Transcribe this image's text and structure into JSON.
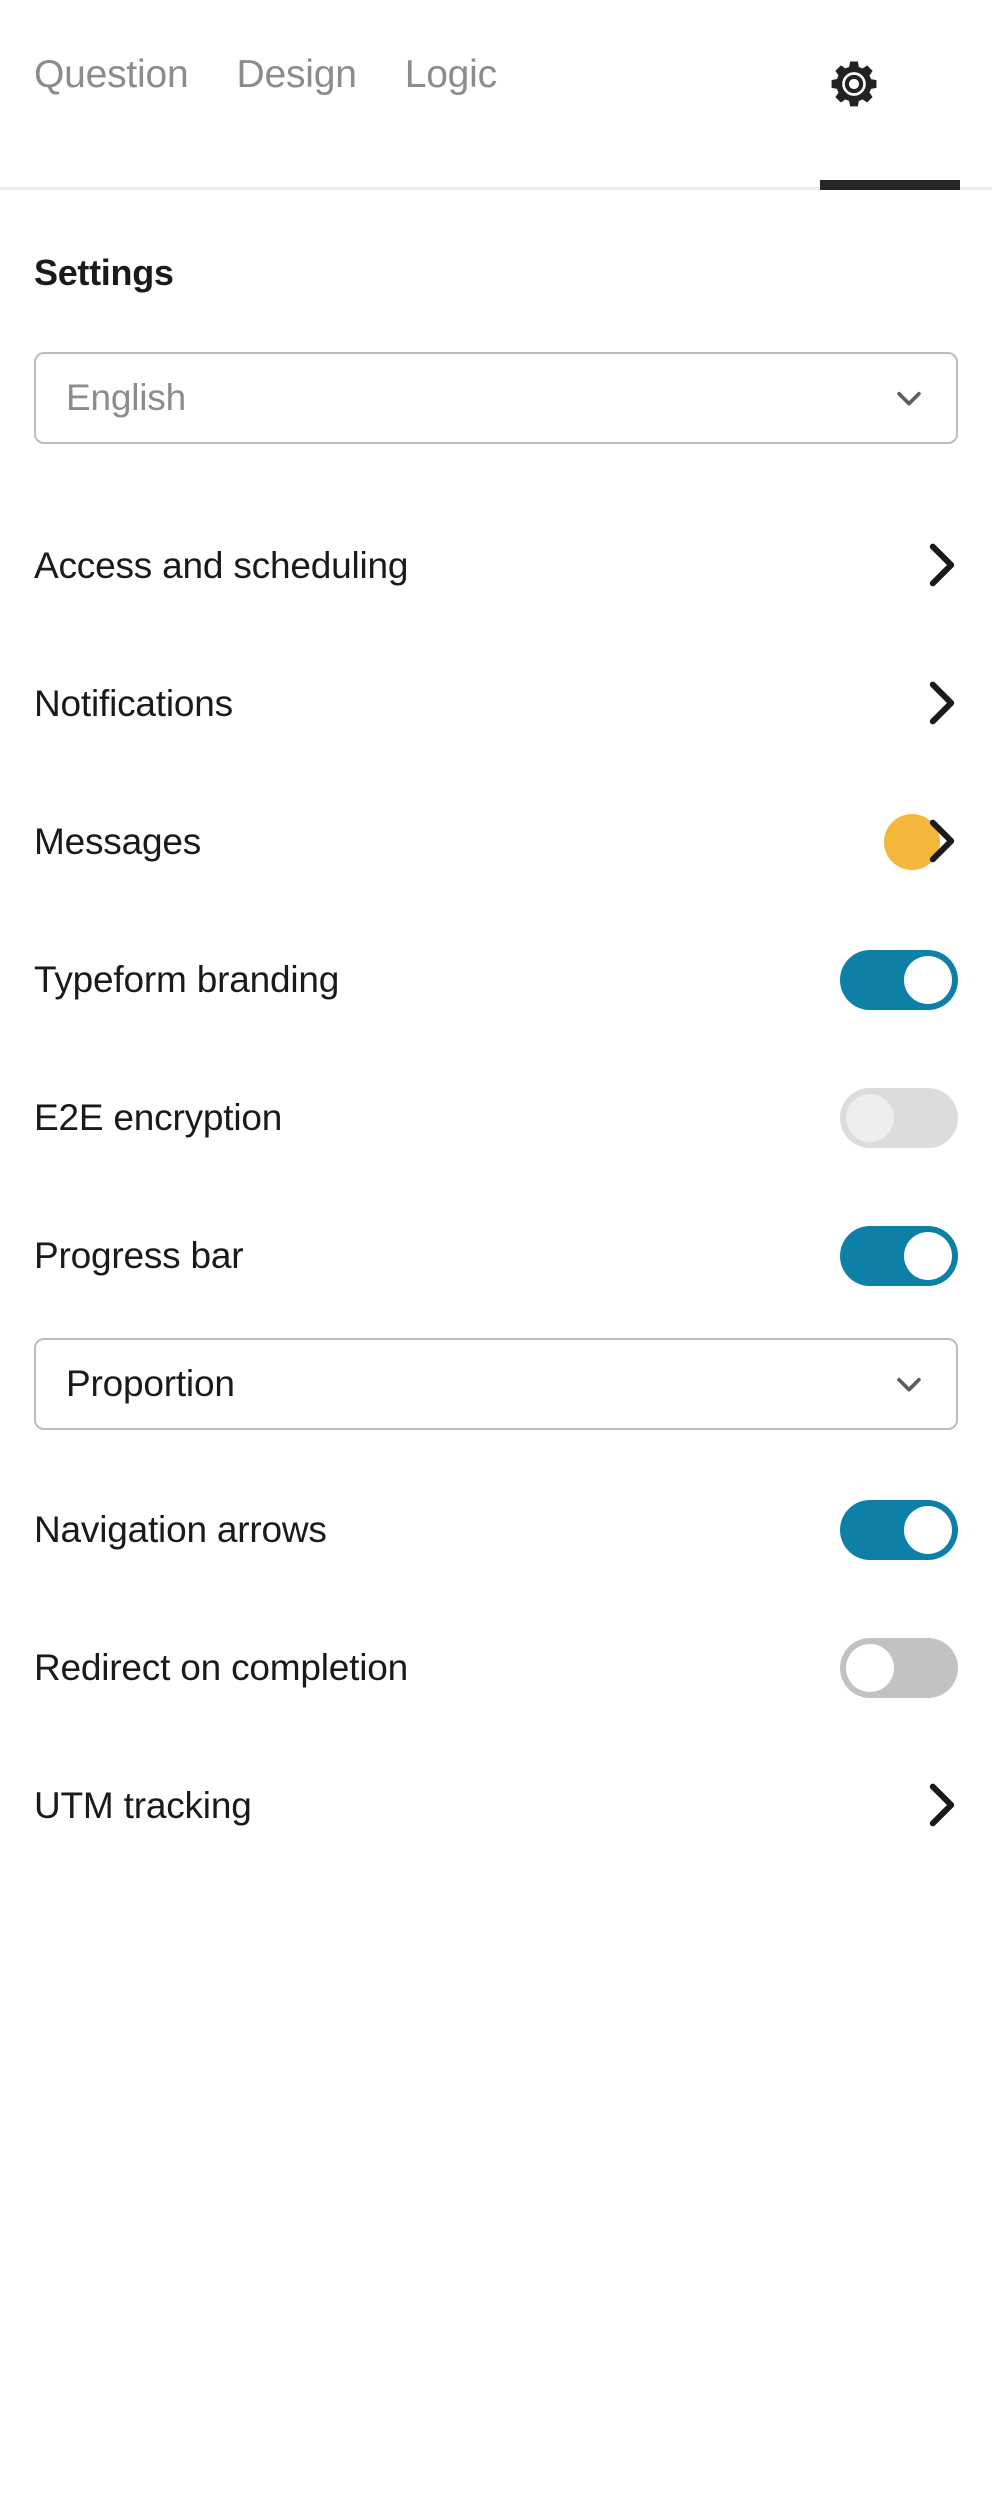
{
  "tabs": [
    {
      "label": "Question",
      "active": false
    },
    {
      "label": "Design",
      "active": false
    },
    {
      "label": "Logic",
      "active": false
    }
  ],
  "settings_tab": {
    "icon": "gear-icon",
    "active": true
  },
  "section": {
    "title": "Settings"
  },
  "language_select": {
    "value": "English",
    "chevron": "chevron-down-icon"
  },
  "rows": [
    {
      "label": "Access and scheduling",
      "type": "link",
      "chevron": "chevron-right-icon"
    },
    {
      "label": "Notifications",
      "type": "link",
      "chevron": "chevron-right-icon"
    },
    {
      "label": "Messages",
      "type": "link",
      "chevron": "chevron-right-icon",
      "badge": true
    },
    {
      "label": "Typeform branding",
      "type": "toggle",
      "state": "on"
    },
    {
      "label": "E2E encryption",
      "type": "toggle",
      "state": "off-muted"
    },
    {
      "label": "Progress bar",
      "type": "toggle",
      "state": "on"
    },
    {
      "label": "Navigation arrows",
      "type": "toggle",
      "state": "on"
    },
    {
      "label": "Redirect on completion",
      "type": "toggle",
      "state": "off"
    },
    {
      "label": "UTM tracking",
      "type": "link",
      "chevron": "chevron-right-icon"
    }
  ],
  "progress_select": {
    "value": "Proportion",
    "chevron": "chevron-down-icon"
  },
  "colors": {
    "toggle_on": "#0E80A8",
    "toggle_off": "#c2c2c2",
    "toggle_off_muted": "#dcdcdc",
    "badge": "#F5B63C",
    "tab_inactive": "#8c8c8c",
    "text": "#1a1a1a",
    "border": "#bdbdbd",
    "active_underline": "#262626"
  }
}
